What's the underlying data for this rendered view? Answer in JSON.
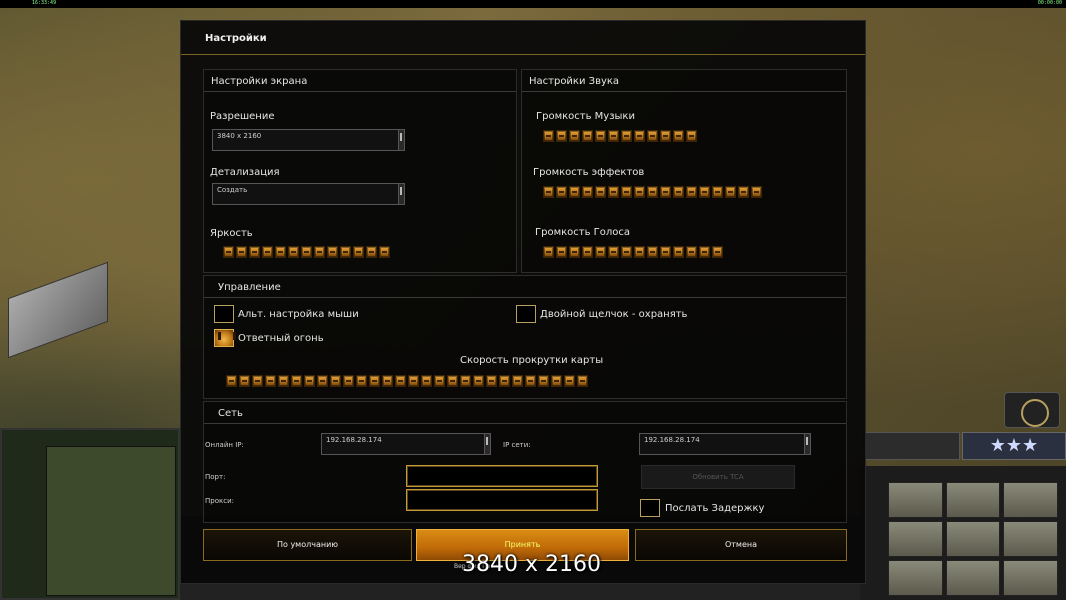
{
  "topbar": {
    "left": "16:33:49",
    "right": "00:00:00"
  },
  "hud": {
    "rank": "★★★"
  },
  "dialog": {
    "title": "Настройки"
  },
  "screen": {
    "title": "Настройки экрана",
    "resolution_label": "Разрешение",
    "resolution_value": "3840 x 2160",
    "detail_label": "Детализация",
    "detail_value": "Создать",
    "brightness_label": "Яркость",
    "brightness_level": 13
  },
  "sound": {
    "title": "Настройки Звука",
    "music_label": "Громкость Музыки",
    "music_level": 12,
    "effects_label": "Громкость эффектов",
    "effects_level": 17,
    "voice_label": "Громкость Голоса",
    "voice_level": 14
  },
  "controls": {
    "title": "Управление",
    "alt_mouse_label": "Альт. настройка мыши",
    "alt_mouse_checked": false,
    "double_click_label": "Двойной щелчок - охранять",
    "double_click_checked": false,
    "return_fire_label": "Ответный огонь",
    "return_fire_checked": true,
    "scroll_speed_label": "Скорость прокрутки карты",
    "scroll_speed_level": 28
  },
  "network": {
    "title": "Сеть",
    "online_ip_label": "Онлайн IP:",
    "online_ip_value": "192.168.28.174",
    "lan_ip_label": "IP сети:",
    "lan_ip_value": "192.168.28.174",
    "port_label": "Порт:",
    "proxy_label": "Прокси:",
    "refresh_button": "Обновить TCA",
    "send_delay_label": "Послать Задержку",
    "send_delay_checked": false
  },
  "buttons": {
    "defaults": "По умолчанию",
    "accept": "Принять",
    "cancel": "Отмена"
  },
  "overlay": {
    "version_text": "Вер                   фил Пасха",
    "watermark": "3840 x 2160"
  }
}
